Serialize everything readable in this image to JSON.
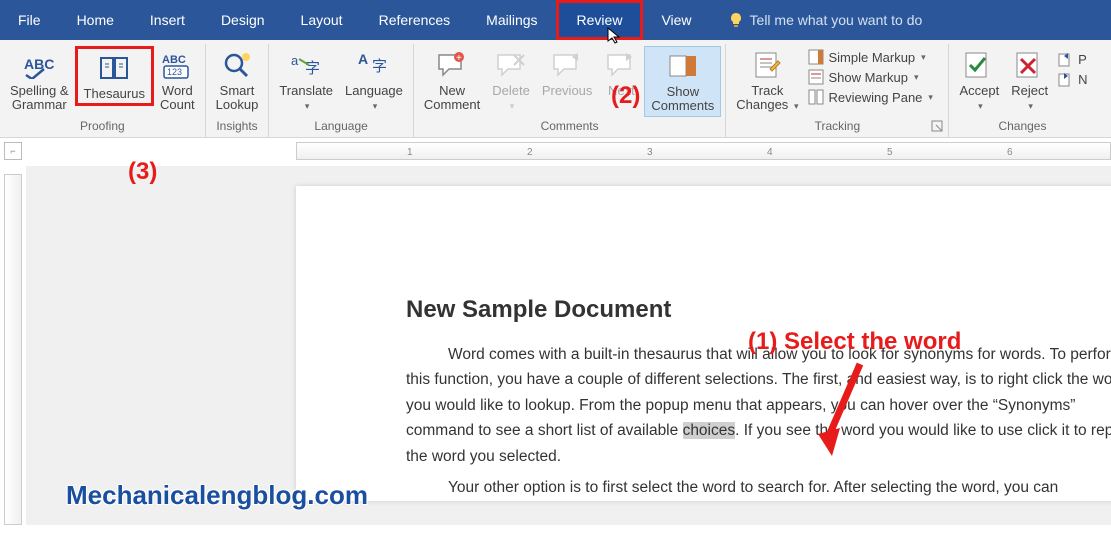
{
  "tabs": {
    "file": "File",
    "home": "Home",
    "insert": "Insert",
    "design": "Design",
    "layout": "Layout",
    "references": "References",
    "mailings": "Mailings",
    "review": "Review",
    "view": "View",
    "tellme": "Tell me what you want to do"
  },
  "groups": {
    "proofing": {
      "label": "Proofing",
      "spelling": "Spelling &\nGrammar",
      "thesaurus": "Thesaurus",
      "wordcount": "Word\nCount"
    },
    "insights": {
      "label": "Insights",
      "smartlookup": "Smart\nLookup"
    },
    "language": {
      "label": "Language",
      "translate": "Translate",
      "language": "Language"
    },
    "comments": {
      "label": "Comments",
      "new": "New\nComment",
      "delete": "Delete",
      "previous": "Previous",
      "next": "Next",
      "show": "Show\nComments"
    },
    "tracking": {
      "label": "Tracking",
      "track": "Track\nChanges",
      "simple_markup": "Simple Markup",
      "show_markup": "Show Markup",
      "reviewing_pane": "Reviewing Pane"
    },
    "changes": {
      "label": "Changes",
      "accept": "Accept",
      "reject": "Reject",
      "prev": "P",
      "next": "N"
    }
  },
  "ruler": {
    "major_ticks": [
      "1",
      "2",
      "3",
      "4",
      "5",
      "6"
    ]
  },
  "document": {
    "title": "New Sample Document",
    "p1_a": "Word comes with a built-in thesaurus that will allow you to look for synonyms for words. To perform this function, you have a couple of different selections. The first, and easiest way, is to right click the word you would like to lookup. From the popup menu that appears, you can hover over the “Synonyms” command to see a short list of available ",
    "p1_sel": "choices",
    "p1_b": ". If you see the word you would like to use click it to replace the word you selected.",
    "p2": "Your other option is to first select the word to search for. After selecting the word, you can"
  },
  "annotations": {
    "a1": "(1)  Select the word",
    "a2": "(2)",
    "a3": "(3)"
  },
  "watermark": "Mechanicalengblog.com"
}
